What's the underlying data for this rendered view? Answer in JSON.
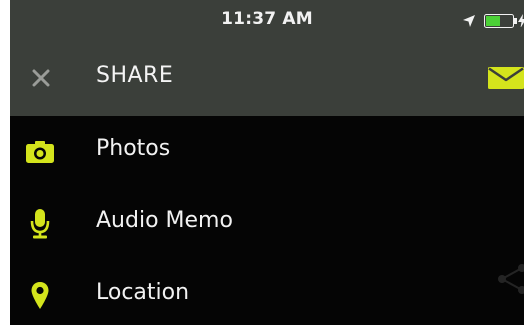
{
  "status_bar": {
    "time": "11:37 AM",
    "icons": [
      "location-arrow-icon",
      "battery-icon",
      "charging-bolt-icon"
    ]
  },
  "header": {
    "close_icon": "close-icon",
    "title": "SHARE",
    "mail_icon": "mail-icon"
  },
  "menu": {
    "items": [
      {
        "label": "Photos",
        "icon": "camera-icon"
      },
      {
        "label": "Audio Memo",
        "icon": "microphone-icon"
      },
      {
        "label": "Location",
        "icon": "map-pin-icon"
      }
    ]
  },
  "colors": {
    "accent": "#d4e41c",
    "bar_background": "#3b3f3a",
    "screen_background": "#050505",
    "text": "#f2f2f2",
    "close_icon": "#9a9c98",
    "battery": "#4cd137"
  }
}
